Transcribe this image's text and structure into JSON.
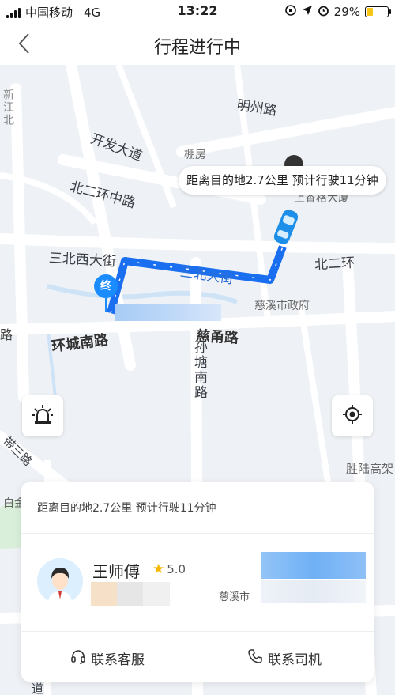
{
  "status_bar": {
    "carrier": "中国移动",
    "network": "4G",
    "time": "13:22",
    "battery": "29%",
    "battery_level": 0.29
  },
  "nav": {
    "title": "行程进行中"
  },
  "map": {
    "eta_bubble": "距离目的地2.7公里 预计行驶11分钟",
    "end_marker": "终",
    "labels": {
      "mingzhou_rd": "明州路",
      "kaifa_ave": "开发大道",
      "pengfang": "棚房",
      "shangri_la": "上香格大厦",
      "beierhuan_zhong": "北二环中路",
      "sanbei_west": "三北西大街",
      "beierhuan": "北二环",
      "sanbei": "三北大街",
      "cixi_gov": "慈溪市政府",
      "huancheng_south": "环城南路",
      "cinan_rd": "慈甬路",
      "suntang_south": "孙塘南路",
      "xinjiang_north": "新江北",
      "shengluo": "胜陆高架",
      "baijin": "白金",
      "road_lu_left": "路",
      "road_side": "带三路",
      "dao": "道"
    }
  },
  "colors": {
    "route": "#1a6ff0",
    "accent": "#1a8cff",
    "star": "#f6b600"
  },
  "card": {
    "eta": "距离目的地2.7公里 预计行驶11分钟",
    "driver_name": "王师傅",
    "rating": "5.0",
    "city": "慈溪市",
    "contact_service": "联系客服",
    "contact_driver": "联系司机"
  },
  "icons": {
    "back": "chevron-left-icon",
    "alarm": "alarm-light-icon",
    "locate": "locate-icon",
    "headset": "headset-icon",
    "phone": "phone-icon"
  }
}
